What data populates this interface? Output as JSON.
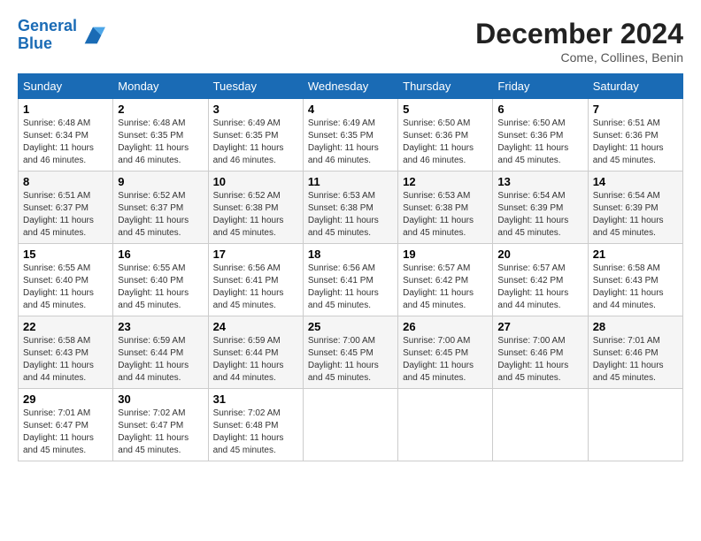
{
  "header": {
    "logo_line1": "General",
    "logo_line2": "Blue",
    "month_title": "December 2024",
    "location": "Come, Collines, Benin"
  },
  "days_of_week": [
    "Sunday",
    "Monday",
    "Tuesday",
    "Wednesday",
    "Thursday",
    "Friday",
    "Saturday"
  ],
  "weeks": [
    [
      {
        "num": "1",
        "detail": "Sunrise: 6:48 AM\nSunset: 6:34 PM\nDaylight: 11 hours\nand 46 minutes."
      },
      {
        "num": "2",
        "detail": "Sunrise: 6:48 AM\nSunset: 6:35 PM\nDaylight: 11 hours\nand 46 minutes."
      },
      {
        "num": "3",
        "detail": "Sunrise: 6:49 AM\nSunset: 6:35 PM\nDaylight: 11 hours\nand 46 minutes."
      },
      {
        "num": "4",
        "detail": "Sunrise: 6:49 AM\nSunset: 6:35 PM\nDaylight: 11 hours\nand 46 minutes."
      },
      {
        "num": "5",
        "detail": "Sunrise: 6:50 AM\nSunset: 6:36 PM\nDaylight: 11 hours\nand 46 minutes."
      },
      {
        "num": "6",
        "detail": "Sunrise: 6:50 AM\nSunset: 6:36 PM\nDaylight: 11 hours\nand 45 minutes."
      },
      {
        "num": "7",
        "detail": "Sunrise: 6:51 AM\nSunset: 6:36 PM\nDaylight: 11 hours\nand 45 minutes."
      }
    ],
    [
      {
        "num": "8",
        "detail": "Sunrise: 6:51 AM\nSunset: 6:37 PM\nDaylight: 11 hours\nand 45 minutes."
      },
      {
        "num": "9",
        "detail": "Sunrise: 6:52 AM\nSunset: 6:37 PM\nDaylight: 11 hours\nand 45 minutes."
      },
      {
        "num": "10",
        "detail": "Sunrise: 6:52 AM\nSunset: 6:38 PM\nDaylight: 11 hours\nand 45 minutes."
      },
      {
        "num": "11",
        "detail": "Sunrise: 6:53 AM\nSunset: 6:38 PM\nDaylight: 11 hours\nand 45 minutes."
      },
      {
        "num": "12",
        "detail": "Sunrise: 6:53 AM\nSunset: 6:38 PM\nDaylight: 11 hours\nand 45 minutes."
      },
      {
        "num": "13",
        "detail": "Sunrise: 6:54 AM\nSunset: 6:39 PM\nDaylight: 11 hours\nand 45 minutes."
      },
      {
        "num": "14",
        "detail": "Sunrise: 6:54 AM\nSunset: 6:39 PM\nDaylight: 11 hours\nand 45 minutes."
      }
    ],
    [
      {
        "num": "15",
        "detail": "Sunrise: 6:55 AM\nSunset: 6:40 PM\nDaylight: 11 hours\nand 45 minutes."
      },
      {
        "num": "16",
        "detail": "Sunrise: 6:55 AM\nSunset: 6:40 PM\nDaylight: 11 hours\nand 45 minutes."
      },
      {
        "num": "17",
        "detail": "Sunrise: 6:56 AM\nSunset: 6:41 PM\nDaylight: 11 hours\nand 45 minutes."
      },
      {
        "num": "18",
        "detail": "Sunrise: 6:56 AM\nSunset: 6:41 PM\nDaylight: 11 hours\nand 45 minutes."
      },
      {
        "num": "19",
        "detail": "Sunrise: 6:57 AM\nSunset: 6:42 PM\nDaylight: 11 hours\nand 45 minutes."
      },
      {
        "num": "20",
        "detail": "Sunrise: 6:57 AM\nSunset: 6:42 PM\nDaylight: 11 hours\nand 44 minutes."
      },
      {
        "num": "21",
        "detail": "Sunrise: 6:58 AM\nSunset: 6:43 PM\nDaylight: 11 hours\nand 44 minutes."
      }
    ],
    [
      {
        "num": "22",
        "detail": "Sunrise: 6:58 AM\nSunset: 6:43 PM\nDaylight: 11 hours\nand 44 minutes."
      },
      {
        "num": "23",
        "detail": "Sunrise: 6:59 AM\nSunset: 6:44 PM\nDaylight: 11 hours\nand 44 minutes."
      },
      {
        "num": "24",
        "detail": "Sunrise: 6:59 AM\nSunset: 6:44 PM\nDaylight: 11 hours\nand 44 minutes."
      },
      {
        "num": "25",
        "detail": "Sunrise: 7:00 AM\nSunset: 6:45 PM\nDaylight: 11 hours\nand 45 minutes."
      },
      {
        "num": "26",
        "detail": "Sunrise: 7:00 AM\nSunset: 6:45 PM\nDaylight: 11 hours\nand 45 minutes."
      },
      {
        "num": "27",
        "detail": "Sunrise: 7:00 AM\nSunset: 6:46 PM\nDaylight: 11 hours\nand 45 minutes."
      },
      {
        "num": "28",
        "detail": "Sunrise: 7:01 AM\nSunset: 6:46 PM\nDaylight: 11 hours\nand 45 minutes."
      }
    ],
    [
      {
        "num": "29",
        "detail": "Sunrise: 7:01 AM\nSunset: 6:47 PM\nDaylight: 11 hours\nand 45 minutes."
      },
      {
        "num": "30",
        "detail": "Sunrise: 7:02 AM\nSunset: 6:47 PM\nDaylight: 11 hours\nand 45 minutes."
      },
      {
        "num": "31",
        "detail": "Sunrise: 7:02 AM\nSunset: 6:48 PM\nDaylight: 11 hours\nand 45 minutes."
      },
      null,
      null,
      null,
      null
    ]
  ]
}
